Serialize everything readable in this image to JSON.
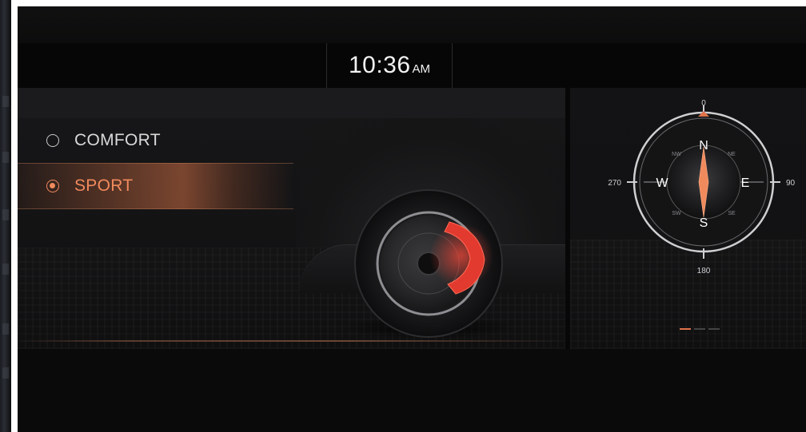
{
  "clock": {
    "time": "10:36",
    "ampm": "AM"
  },
  "drive_modes": [
    {
      "label": "COMFORT",
      "selected": false
    },
    {
      "label": "SPORT",
      "selected": true
    }
  ],
  "compass": {
    "degrees": {
      "top": "0",
      "right": "90",
      "bottom": "180",
      "left": "270"
    },
    "cardinals": {
      "n": "N",
      "e": "E",
      "s": "S",
      "w": "W"
    },
    "intercardinals": {
      "nw": "NW",
      "ne": "NE",
      "sw": "SW",
      "se": "SE"
    }
  },
  "pager": {
    "pages": 3,
    "active": 1
  },
  "colors": {
    "accent": "#f08a5d",
    "background": "#0b0b0c",
    "text": "#d9d9d9",
    "brake_caliper": "#e23a2f"
  },
  "icons": [
    "radio-unchecked-icon",
    "radio-checked-icon",
    "wheel-brake-illustration",
    "compass-icon"
  ]
}
